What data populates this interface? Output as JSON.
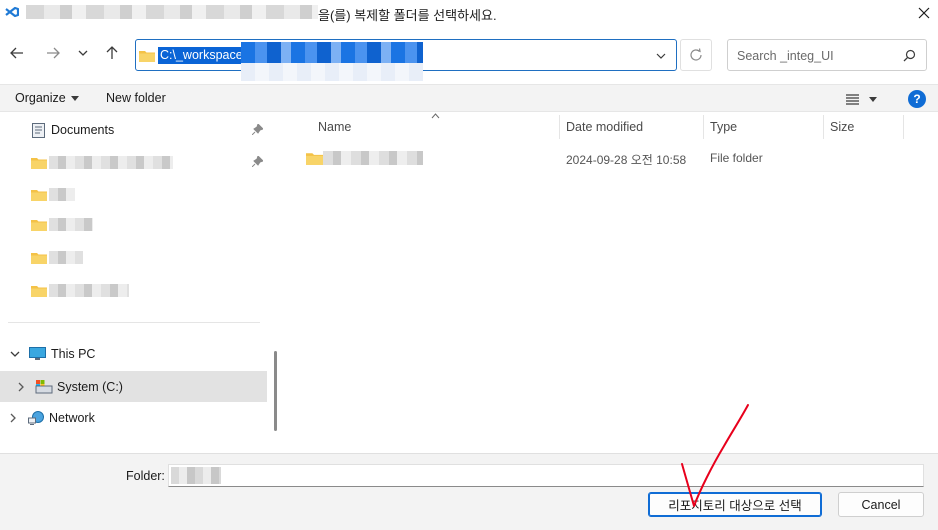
{
  "window": {
    "title_suffix": "을(를) 복제할 폴더를 선택하세요."
  },
  "nav": {
    "address_text": "C:\\_workspace\\",
    "search_placeholder": "Search _integ_UI"
  },
  "toolbar": {
    "organize_label": "Organize",
    "new_folder_label": "New folder"
  },
  "sidebar": {
    "documents_label": "Documents",
    "this_pc_label": "This PC",
    "system_drive_label": "System (C:)",
    "network_label": "Network"
  },
  "filelist": {
    "columns": {
      "name": "Name",
      "date_modified": "Date modified",
      "type": "Type",
      "size": "Size"
    },
    "rows": [
      {
        "date": "2024-09-28 오전 10:58",
        "type": "File folder"
      }
    ]
  },
  "footer": {
    "folder_label": "Folder:",
    "select_button_label": "리포지토리 대상으로 선택",
    "cancel_button_label": "Cancel"
  },
  "colors": {
    "accent": "#0f6cd5",
    "selection": "#0a64d6",
    "folder": "#f4c247",
    "annotation": "#e8001c"
  }
}
